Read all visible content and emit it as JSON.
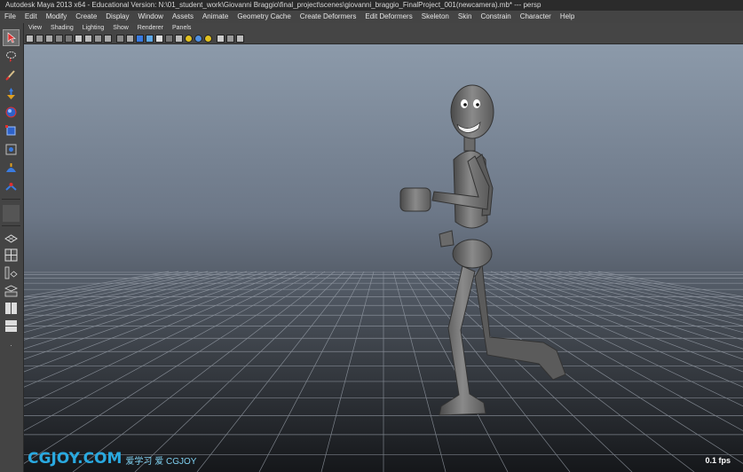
{
  "window": {
    "title": "Autodesk Maya 2013 x64 - Educational Version: N:\\01_student_work\\Giovanni Braggio\\final_project\\scenes\\giovanni_braggio_FinalProject_001(newcamera).mb*  ---  persp"
  },
  "menu": [
    "File",
    "Edit",
    "Modify",
    "Create",
    "Display",
    "Window",
    "Assets",
    "Animate",
    "Geometry Cache",
    "Create Deformers",
    "Edit Deformers",
    "Skeleton",
    "Skin",
    "Constrain",
    "Character",
    "Help"
  ],
  "panel_menu": [
    "View",
    "Shading",
    "Lighting",
    "Show",
    "Renderer",
    "Panels"
  ],
  "toolbox": {
    "tools": [
      "select-tool-icon",
      "lasso-tool-icon",
      "paint-select-tool-icon",
      "move-tool-icon",
      "rotate-tool-icon",
      "scale-tool-icon",
      "universal-manipulator-icon",
      "soft-mod-icon",
      "show-manipulator-icon"
    ],
    "layouts": [
      "single-perspective-layout-icon",
      "four-view-layout-icon",
      "outliner-persp-layout-icon",
      "graph-editor-layout-icon",
      "two-pane-vertical-layout-icon",
      "two-pane-horizontal-layout-icon"
    ]
  },
  "viewport": {
    "fps": "0.1 fps",
    "camera": "persp"
  },
  "watermark": {
    "cn_text": "爱学习 爱 CGJOY",
    "brand_left": "CG",
    "brand_right": "JOY.COM"
  },
  "colors": {
    "accent_blue": "#29a9e0",
    "selected_tool": "#6d6d6d",
    "viewport_top": "#8c9aaa",
    "viewport_bottom": "#15171a"
  }
}
